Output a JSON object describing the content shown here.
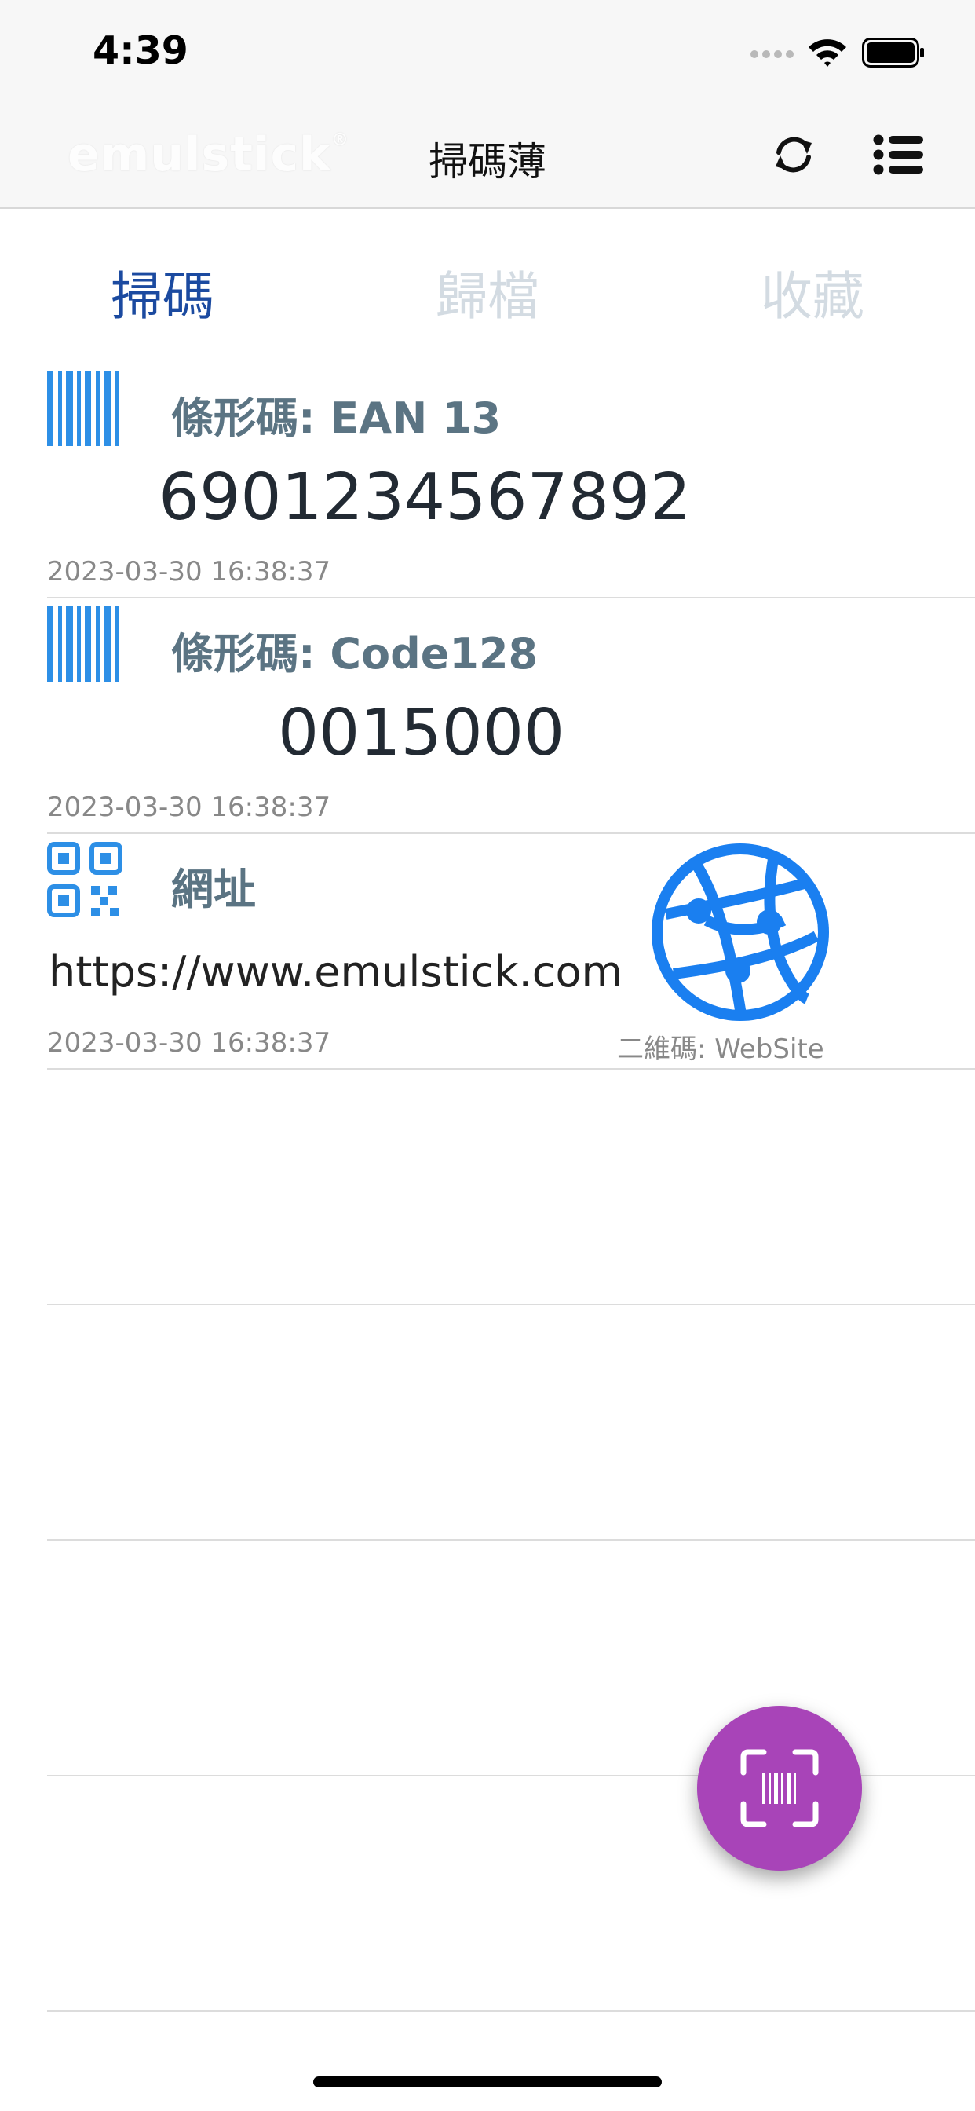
{
  "status": {
    "time": "4:39"
  },
  "header": {
    "logo_text": "emulstick",
    "logo_mark": "®",
    "title": "掃碼薄",
    "refresh_icon": "refresh-icon",
    "menu_icon": "list-menu-icon"
  },
  "tabs": [
    {
      "label": "掃碼",
      "active": true
    },
    {
      "label": "歸檔",
      "active": false
    },
    {
      "label": "收藏",
      "active": false
    }
  ],
  "records": [
    {
      "icon": "barcode-icon",
      "type_label": "條形碼: EAN 13",
      "value": "6901234567892",
      "timestamp": "2023-03-30 16:38:37"
    },
    {
      "icon": "barcode-icon",
      "type_label": "條形碼: Code128",
      "value": "0015000",
      "timestamp": "2023-03-30 16:38:37"
    },
    {
      "icon": "qrcode-icon",
      "type_label": "網址",
      "value": "https://www.emulstick.com",
      "timestamp": "2023-03-30 16:38:37",
      "sub_label": "二維碼: WebSite",
      "extra_icon": "globe-icon"
    }
  ],
  "fab": {
    "icon": "scan-barcode-icon"
  },
  "colors": {
    "accent": "#1b4aa0",
    "icon_blue": "#2d8fe6",
    "globe_blue": "#1a7ff0",
    "fab": "#a844b8",
    "label": "#5b7483"
  }
}
